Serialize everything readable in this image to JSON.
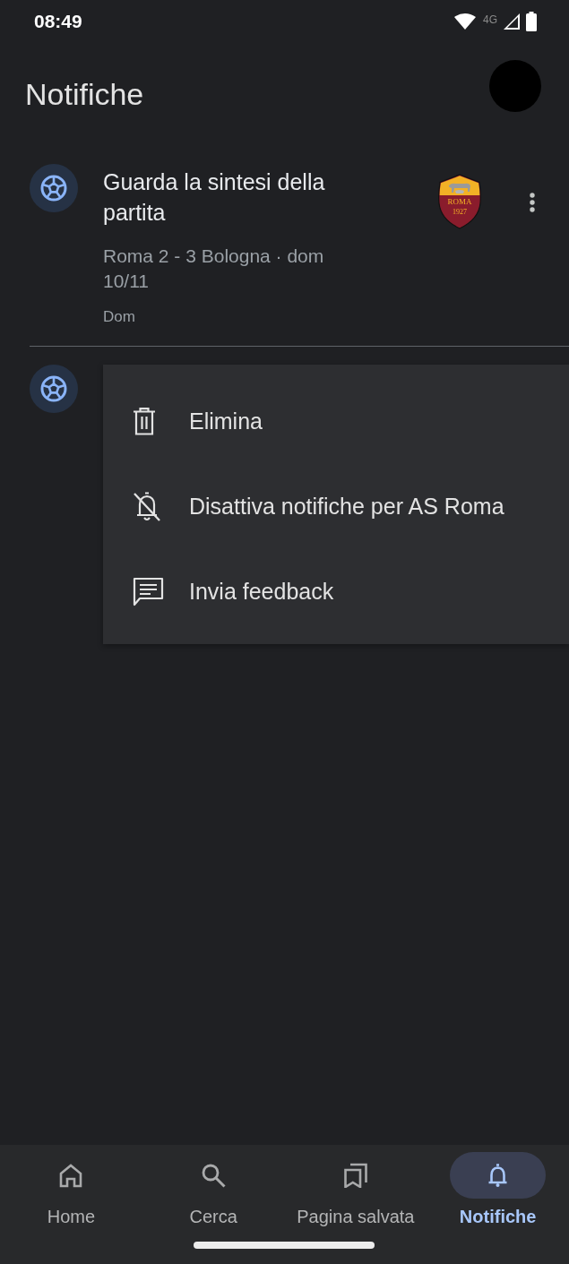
{
  "status_bar": {
    "time": "08:49",
    "network_type": "4G"
  },
  "header": {
    "title": "Notifiche"
  },
  "notifications": [
    {
      "title": "Guarda la sintesi della partita",
      "subtitle": "Roma 2 - 3 Bologna · dom 10/11",
      "time": "Dom",
      "crest": {
        "name": "ROMA",
        "year": "1927"
      },
      "menu_open": true
    },
    {
      "menu_open": false
    }
  ],
  "menu": {
    "items": [
      {
        "label": "Elimina"
      },
      {
        "label": "Disattiva notifiche per AS Roma"
      },
      {
        "label": "Invia feedback"
      }
    ]
  },
  "nav": {
    "items": [
      {
        "label": "Home",
        "selected": false
      },
      {
        "label": "Cerca",
        "selected": false
      },
      {
        "label": "Pagina salvata",
        "selected": false
      },
      {
        "label": "Notifiche",
        "selected": true
      }
    ]
  }
}
